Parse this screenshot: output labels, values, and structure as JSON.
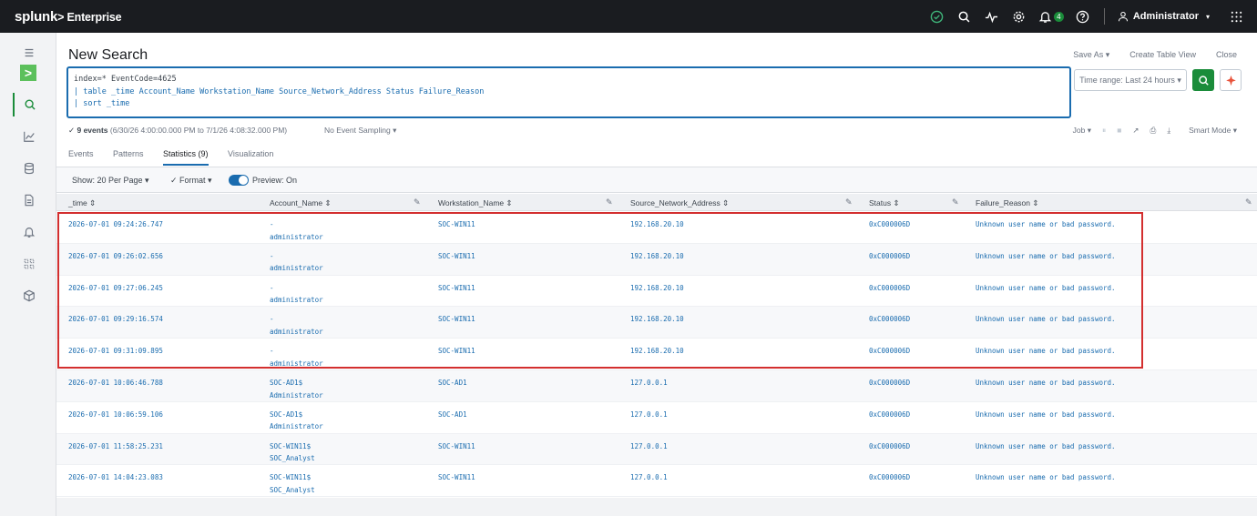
{
  "topbar": {
    "logo": "splunk",
    "product": "> Enterprise",
    "notification_count": "4",
    "user": "Administrator"
  },
  "page": {
    "title": "New Search",
    "save_as": "Save As ▾",
    "create_table_view": "Create Table View",
    "close": "Close"
  },
  "query": {
    "line1": "index=* EventCode=4625",
    "line2": "| table _time Account_Name Workstation_Name Source_Network_Address Status Failure_Reason",
    "line3": "| sort _time"
  },
  "controls": {
    "time_range": "Time range: Last 24 hours ▾",
    "events_count": "✓ 9 events",
    "events_range": "(6/30/26 4:00:00.000 PM to 7/1/26 4:08:32.000 PM)",
    "sampling": "No Event Sampling ▾",
    "job": "Job ▾",
    "smart_mode": "Smart Mode ▾"
  },
  "tabs": [
    "Events",
    "Patterns",
    "Statistics (9)",
    "Visualization"
  ],
  "options": {
    "per_page": "Show: 20 Per Page ▾",
    "format": "✓ Format ▾",
    "preview": "Preview: On"
  },
  "columns": [
    "_time ⇕",
    "Account_Name ⇕",
    "Workstation_Name ⇕",
    "Source_Network_Address ⇕",
    "Status ⇕",
    "Failure_Reason ⇕"
  ],
  "rows": [
    {
      "time": "2026-07-01 09:24:26.747",
      "acct1": "-",
      "acct2": "administrator",
      "ws": "SOC-WIN11",
      "src": "192.168.20.10",
      "status": "0xC000006D",
      "reason": "Unknown user name or bad password."
    },
    {
      "time": "2026-07-01 09:26:02.656",
      "acct1": "-",
      "acct2": "administrator",
      "ws": "SOC-WIN11",
      "src": "192.168.20.10",
      "status": "0xC000006D",
      "reason": "Unknown user name or bad password."
    },
    {
      "time": "2026-07-01 09:27:06.245",
      "acct1": "-",
      "acct2": "administrator",
      "ws": "SOC-WIN11",
      "src": "192.168.20.10",
      "status": "0xC000006D",
      "reason": "Unknown user name or bad password."
    },
    {
      "time": "2026-07-01 09:29:16.574",
      "acct1": "-",
      "acct2": "administrator",
      "ws": "SOC-WIN11",
      "src": "192.168.20.10",
      "status": "0xC000006D",
      "reason": "Unknown user name or bad password."
    },
    {
      "time": "2026-07-01 09:31:09.895",
      "acct1": "-",
      "acct2": "administrator",
      "ws": "SOC-WIN11",
      "src": "192.168.20.10",
      "status": "0xC000006D",
      "reason": "Unknown user name or bad password."
    },
    {
      "time": "2026-07-01 10:06:46.788",
      "acct1": "SOC-AD1$",
      "acct2": "Administrator",
      "ws": "SOC-AD1",
      "src": "127.0.0.1",
      "status": "0xC000006D",
      "reason": "Unknown user name or bad password."
    },
    {
      "time": "2026-07-01 10:06:59.106",
      "acct1": "SOC-AD1$",
      "acct2": "Administrator",
      "ws": "SOC-AD1",
      "src": "127.0.0.1",
      "status": "0xC000006D",
      "reason": "Unknown user name or bad password."
    },
    {
      "time": "2026-07-01 11:58:25.231",
      "acct1": "SOC-WIN11$",
      "acct2": "SOC_Analyst",
      "ws": "SOC-WIN11",
      "src": "127.0.0.1",
      "status": "0xC000006D",
      "reason": "Unknown user name or bad password."
    },
    {
      "time": "2026-07-01 14:04:23.083",
      "acct1": "SOC-WIN11$",
      "acct2": "SOC_Analyst",
      "ws": "SOC-WIN11",
      "src": "127.0.0.1",
      "status": "0xC000006D",
      "reason": "Unknown user name or bad password."
    }
  ],
  "colors": {
    "accent": "#1a6caf",
    "brand_green": "#1a8c3a",
    "highlight": "#d32f2f"
  }
}
